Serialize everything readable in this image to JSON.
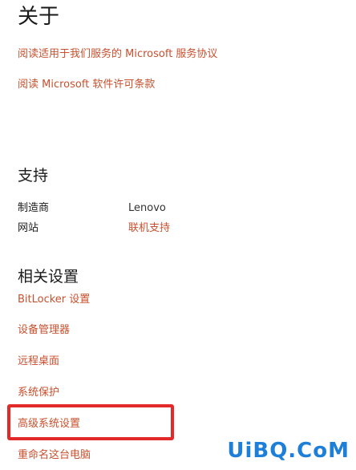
{
  "about": {
    "title": "关于",
    "links": [
      "阅读适用于我们服务的 Microsoft 服务协议",
      "阅读 Microsoft 软件许可条款"
    ]
  },
  "support": {
    "title": "支持",
    "rows": [
      {
        "label": "制造商",
        "value": "Lenovo"
      },
      {
        "label": "网站",
        "value": "联机支持"
      }
    ]
  },
  "related": {
    "title": "相关设置",
    "links": [
      "BitLocker 设置",
      "设备管理器",
      "远程桌面",
      "系统保护",
      "高级系统设置",
      "重命名这台电脑"
    ]
  },
  "watermark": "UiBQ.CoM",
  "colors": {
    "link": "#c8502e",
    "highlight": "#e22a2a",
    "watermark": "#1e7fd8"
  }
}
